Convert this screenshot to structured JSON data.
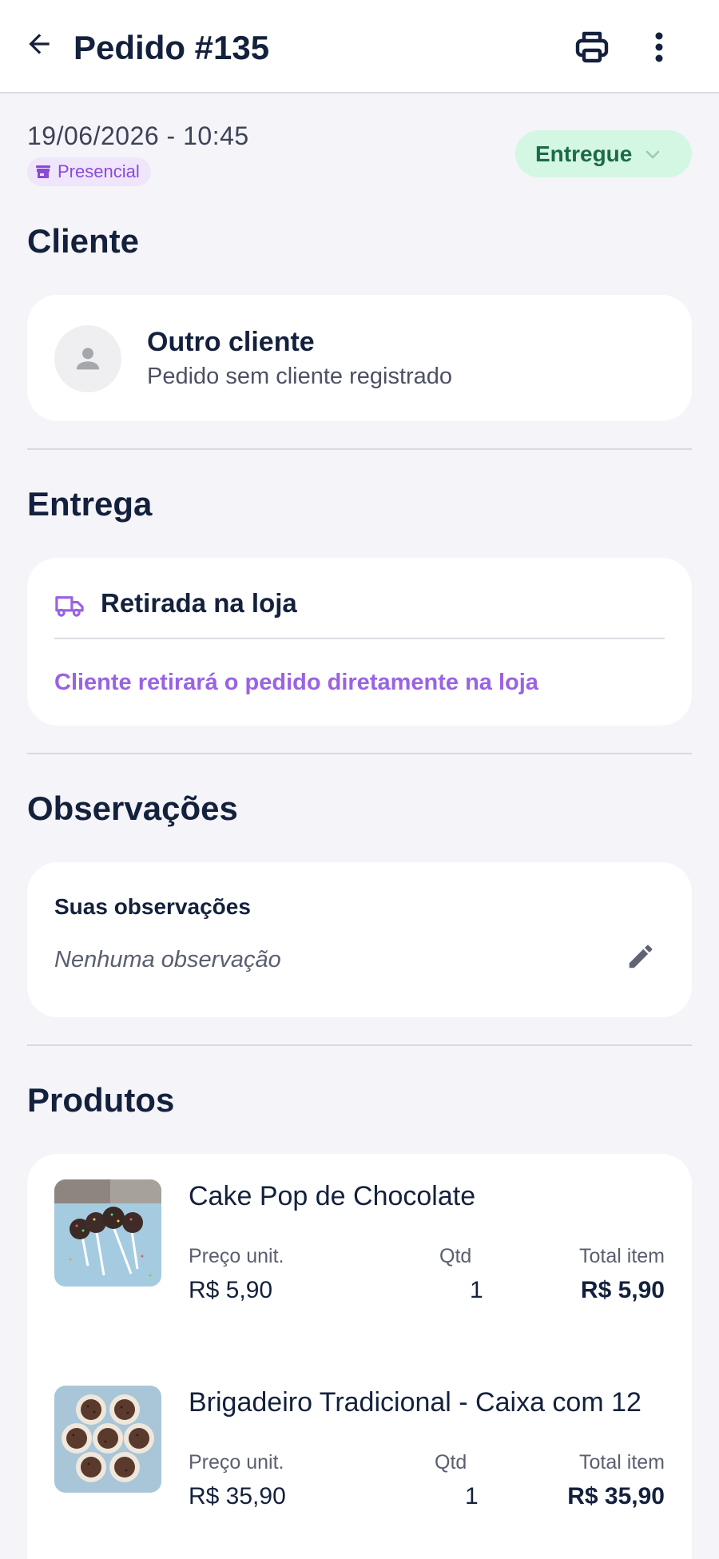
{
  "header": {
    "title": "Pedido #135"
  },
  "order": {
    "datetime": "19/06/2026 - 10:45",
    "channel": "Presencial",
    "status": "Entregue"
  },
  "client_section": {
    "title": "Cliente",
    "name": "Outro cliente",
    "subtitle": "Pedido sem cliente registrado"
  },
  "delivery_section": {
    "title": "Entrega",
    "method": "Retirada na loja",
    "description": "Cliente retirará o pedido diretamente na loja"
  },
  "notes_section": {
    "title": "Observações",
    "label": "Suas observações",
    "value": "Nenhuma observação"
  },
  "products_section": {
    "title": "Produtos",
    "items": [
      {
        "name": "Cake Pop de Chocolate",
        "unit_price_label": "Preço unit.",
        "unit_price": "R$ 5,90",
        "qty_label": "Qtd",
        "qty": "1",
        "total_label": "Total item",
        "total": "R$ 5,90"
      },
      {
        "name": "Brigadeiro Tradicional - Caixa com 12",
        "unit_price_label": "Preço unit.",
        "unit_price": "R$ 35,90",
        "qty_label": "Qtd",
        "qty": "1",
        "total_label": "Total item",
        "total": "R$ 35,90"
      }
    ]
  },
  "icons": {
    "back": "arrow-left-icon",
    "print": "printer-icon",
    "more": "more-vertical-icon",
    "channel": "store-icon",
    "status_dropdown": "chevron-down-icon",
    "avatar": "person-icon",
    "delivery": "truck-icon",
    "edit": "pencil-icon"
  },
  "colors": {
    "background": "#f4f4f9",
    "primary_text": "#14213d",
    "accent_purple": "#9a62e4",
    "status_bg": "#d4f7e3",
    "status_text": "#1c6b45"
  }
}
